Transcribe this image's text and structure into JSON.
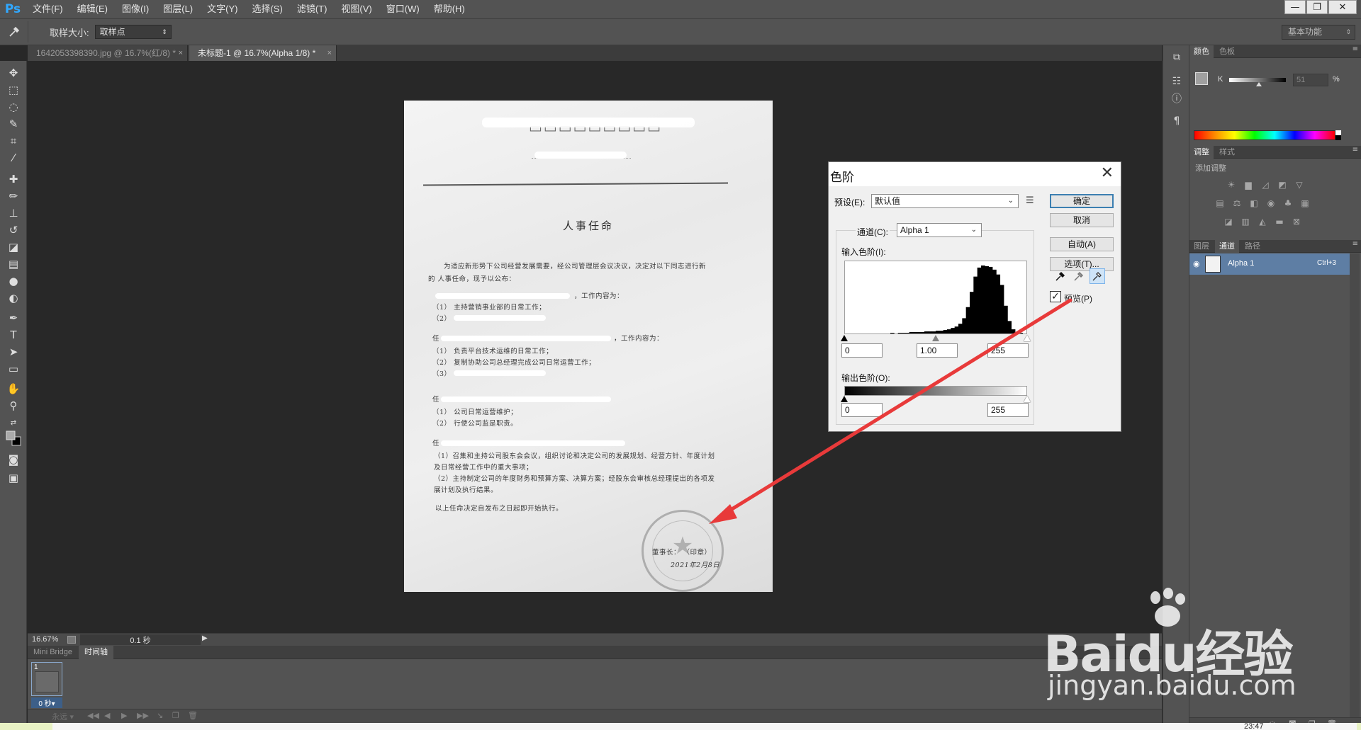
{
  "app": {
    "logo": "Ps",
    "menu": [
      "文件(F)",
      "编辑(E)",
      "图像(I)",
      "图层(L)",
      "文字(Y)",
      "选择(S)",
      "滤镜(T)",
      "视图(V)",
      "窗口(W)",
      "帮助(H)"
    ],
    "window_controls": [
      "—",
      "❐",
      "✕"
    ]
  },
  "options_bar": {
    "tool_icon": "eyedropper-icon",
    "sample_size_label": "取样大小:",
    "sample_size_value": "取样点",
    "workspace": "基本功能"
  },
  "document_tabs": [
    {
      "label": "1642053398390.jpg @ 16.7%(红/8) *",
      "close": "×"
    },
    {
      "label": "未标题-1 @ 16.7%(Alpha 1/8) *",
      "close": "×"
    }
  ],
  "document": {
    "title": "人事任命",
    "intro_line1": "为适应新形势下公司经营发展需要，经公司管理层会议决议，决定对以下同志进行新",
    "intro_line2": "的 人事任命，现予以公布：",
    "line_a_suffix": "，工作内容为：",
    "line_a1": "（1）   主持营销事业部的日常工作；",
    "line_a2": "（2）",
    "line_b_prefix": "任",
    "line_b_suffix": "，工作内容为：",
    "line_b1": "（1）   负责平台技术运维的日常工作；",
    "line_b2": "（2）   复制协助公司总经理完成公司日常运营工作；",
    "line_b3": "（3）",
    "line_c_prefix": "任",
    "line_c1": "（1）   公司日常运营维护；",
    "line_c2": "（2）   行使公司监是职责。",
    "line_d_prefix": "任",
    "line_d1": "（1）召集和主持公司股东会会议，组织讨论和决定公司的发展规划、经营方针、年度计划",
    "line_d2": "及日常经营工作中的重大事项；",
    "line_d3": "（2）主持制定公司的年度财务和预算方案、决算方案；经股东会审核总经理提出的各项发",
    "line_d4": "展计划及执行结果。",
    "closing": "以上任命决定自发布之日起即开始执行。",
    "signature": "董事长：       （印章）",
    "date": "2021年2月8日"
  },
  "levels_dialog": {
    "title": "色阶",
    "close": "✕",
    "preset_label": "预设(E):",
    "preset_value": "默认值",
    "channel_label": "通道(C):",
    "channel_value": "Alpha 1",
    "input_levels_label": "输入色阶(I):",
    "input_black": "0",
    "input_mid": "1.00",
    "input_white": "255",
    "output_levels_label": "输出色阶(O):",
    "output_black": "0",
    "output_white": "255",
    "buttons": {
      "ok": "确定",
      "cancel": "取消",
      "auto": "自动(A)",
      "options": "选项(T)..."
    },
    "preview_label": "预览(P)",
    "preview_checked": "✓",
    "histogram": [
      0,
      0,
      0,
      0,
      0,
      0,
      0,
      0,
      0,
      0,
      0,
      0,
      1,
      0,
      1,
      1,
      1,
      2,
      2,
      2,
      2,
      3,
      3,
      3,
      4,
      4,
      5,
      6,
      8,
      10,
      14,
      22,
      38,
      60,
      82,
      95,
      98,
      97,
      96,
      92,
      85,
      70,
      40,
      18,
      6,
      2,
      1,
      0
    ]
  },
  "status": {
    "zoom": "16.67%",
    "time": "0.1 秒",
    "arrow": "▶"
  },
  "bottom_panel": {
    "tab_bridge": "Mini Bridge",
    "tab_timeline": "时间轴",
    "frame_number": "1",
    "frame_delay": "0 秒▾",
    "loop": "永远 ▾",
    "controls": [
      "◀◀",
      "◀",
      "▶",
      "▶▶",
      "↘",
      "❐",
      "🗑"
    ]
  },
  "right_panels": {
    "color_tabs": [
      "颜色",
      "色板"
    ],
    "k_label": "K",
    "k_value": "51",
    "k_unit": "%",
    "adjust_tabs": [
      "调整",
      "样式"
    ],
    "add_adjustment": "添加调整",
    "layers_tabs": [
      "图层",
      "通道",
      "路径"
    ],
    "channel_name": "Alpha 1",
    "channel_shortcut": "Ctrl+3",
    "menu_glyph": "≡"
  },
  "taskbar": {
    "clock": "23:47"
  },
  "watermark": {
    "brand": "Baidu经验",
    "url": "jingyan.baidu.com"
  },
  "colors": {
    "ui_dark": "#282828",
    "panel": "#535353",
    "selection": "#5e7ea4",
    "arrow": "#e83a3a",
    "ps_blue": "#31a8ff"
  }
}
